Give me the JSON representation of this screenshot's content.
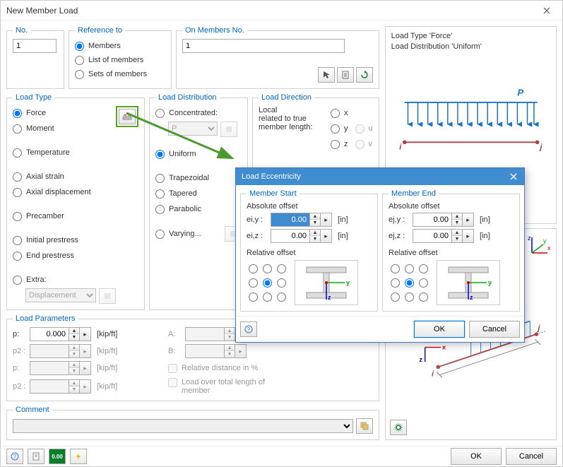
{
  "window": {
    "title": "New Member Load"
  },
  "no": {
    "legend": "No.",
    "value": "1"
  },
  "reference": {
    "legend": "Reference to",
    "members": "Members",
    "list": "List of members",
    "sets": "Sets of members"
  },
  "on_members": {
    "legend": "On Members No.",
    "value": "1"
  },
  "load_type": {
    "legend": "Load Type",
    "force": "Force",
    "moment": "Moment",
    "temperature": "Temperature",
    "axial_strain": "Axial strain",
    "axial_disp": "Axial displacement",
    "precamber": "Precamber",
    "initial_pre": "Initial prestress",
    "end_pre": "End prestress",
    "extra": "Extra:",
    "extra_val": "Displacement"
  },
  "load_dist": {
    "legend": "Load Distribution",
    "concentrated": "Concentrated:",
    "conc_val": "P",
    "uniform": "Uniform",
    "trapezoidal": "Trapezoidal",
    "tapered": "Tapered",
    "parabolic": "Parabolic",
    "varying": "Varying..."
  },
  "load_dir": {
    "legend": "Load Direction",
    "local_label_1": "Local",
    "local_label_2": "related to true",
    "local_label_3": "member length:",
    "x": "x",
    "y": "y",
    "z": "z",
    "u": "u",
    "v": "v"
  },
  "params": {
    "legend": "Load Parameters",
    "p": "p:",
    "p2": "p2 :",
    "A": "A:",
    "B": "B:",
    "val_zero": "0.000",
    "unit": "[kip/ft]",
    "rel": "Relative distance in %",
    "over": "Load over total length of member"
  },
  "comment": {
    "legend": "Comment",
    "value": ""
  },
  "preview": {
    "line1": "Load Type 'Force'",
    "line2": "Load Distribution 'Uniform'",
    "p_label": "P",
    "i": "i",
    "j": "j",
    "x": "x",
    "z": "z"
  },
  "modal": {
    "title": "Load Eccentricity",
    "start": {
      "legend": "Member Start",
      "abs": "Absolute offset",
      "eiy": "ei,y :",
      "eiz": "ei,z :",
      "rel": "Relative offset"
    },
    "end": {
      "legend": "Member End",
      "abs": "Absolute offset",
      "ejy": "ej,y :",
      "ejz": "ej,z :",
      "rel": "Relative offset"
    },
    "val": "0.00",
    "unit": "[in]",
    "y": "y",
    "z": "z",
    "ok": "OK",
    "cancel": "Cancel"
  },
  "footer": {
    "ok": "OK",
    "cancel": "Cancel"
  }
}
